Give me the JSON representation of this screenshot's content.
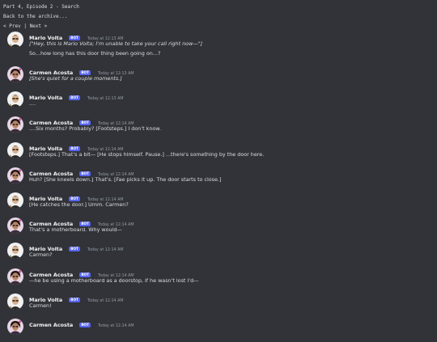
{
  "header": {
    "part_title": "Part 4, Episode 2 - Search",
    "back_link": "Back to the archive...",
    "nav_prev": "< Prev",
    "nav_sep": "|",
    "nav_next": "Next >"
  },
  "bot_badge": "BOT",
  "colors": {
    "background": "#313338",
    "bot_badge": "#5865f2",
    "timestamp": "#949ba4"
  },
  "messages": [
    {
      "author": "Mario Volta",
      "avatar": "mario-avatar",
      "time": "Today at 12:13 AM",
      "lines": [
        "[\"Hey, this is Mario Volta; I'm unable to take your call right now—\"]",
        "So...how long has this door thing been going on...?"
      ]
    },
    {
      "author": "Carmen Acosta",
      "avatar": "carmen-avatar",
      "time": "Today at 12:13 AM",
      "lines": [
        "[She's quiet for a couple moments.]"
      ]
    },
    {
      "author": "Mario Volta",
      "avatar": "mario-avatar",
      "time": "Today at 12:13 AM",
      "lines": [
        "...."
      ]
    },
    {
      "author": "Carmen Acosta",
      "avatar": "carmen-avatar",
      "time": "Today at 12:14 AM",
      "lines": [
        "....Six months? Probably? [Footsteps.] I don't know."
      ]
    },
    {
      "author": "Mario Volta",
      "avatar": "mario-avatar",
      "time": "Today at 12:14 AM",
      "lines": [
        "[Footsteps.] That's a bit— [He stops himself. Pause.] ...there's something by the door here."
      ]
    },
    {
      "author": "Carmen Acosta",
      "avatar": "carmen-avatar",
      "time": "Today at 12:14 AM",
      "lines": [
        "Huh? [She kneels down.] That's. [Fae picks it up. The door starts to close.]"
      ]
    },
    {
      "author": "Mario Volta",
      "avatar": "mario-avatar",
      "time": "Today at 12:14 AM",
      "lines": [
        "[He catches the door.] Umm. Carmen?"
      ]
    },
    {
      "author": "Carmen Acosta",
      "avatar": "carmen-avatar",
      "time": "Today at 12:14 AM",
      "lines": [
        "That's a motherboard. Why would—"
      ]
    },
    {
      "author": "Mario Volta",
      "avatar": "mario-avatar",
      "time": "Today at 12:14 AM",
      "lines": [
        "Carmen?"
      ]
    },
    {
      "author": "Carmen Acosta",
      "avatar": "carmen-avatar",
      "time": "Today at 12:14 AM",
      "lines": [
        "—he be using a motherboard as a doorstop, if he wasn't lost I'd—"
      ]
    },
    {
      "author": "Mario Volta",
      "avatar": "mario-avatar",
      "time": "Today at 12:14 AM",
      "lines": [
        "Carmen!"
      ]
    },
    {
      "author": "Carmen Acosta",
      "avatar": "carmen-avatar",
      "time": "Today at 12:14 AM",
      "lines": []
    }
  ]
}
